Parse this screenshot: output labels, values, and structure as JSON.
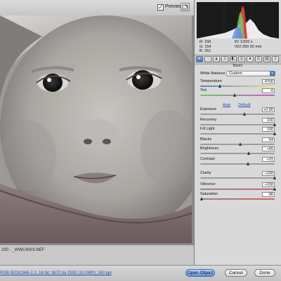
{
  "image_toolbar": {
    "preview_label": "Preview",
    "preview_checked": true,
    "fullscreen_icon": "fullscreen-icon"
  },
  "image_status": {
    "zoom_and_filename": "200   -   _WWC4003.NEF"
  },
  "readout": {
    "r": "R:  158",
    "g": "G:  154",
    "b": "B:  152",
    "exposure_line": "f/2    1/320 s",
    "iso_line": "ISO 200    50 mm"
  },
  "tool_tabs": [
    "basic",
    "tone-curve",
    "detail",
    "hsl",
    "split-toning",
    "lens",
    "camera",
    "presets",
    "snapshots"
  ],
  "section_title": "Basic",
  "white_balance": {
    "label": "White Balance :",
    "value": "Custom"
  },
  "auto_label": "Auto",
  "default_label": "Default",
  "controls": [
    {
      "label": "Temperature",
      "value": "4700",
      "level": 0.27
    },
    {
      "label": "Tint",
      "value": "-6",
      "level": 0.47
    },
    {
      "label": "Exposure",
      "value": "+0.80",
      "level": 0.6
    },
    {
      "label": "Recovery",
      "value": "100",
      "level": 1.0
    },
    {
      "label": "Fill Light",
      "value": "100",
      "level": 1.0
    },
    {
      "label": "Blacks",
      "value": "54",
      "level": 0.54
    },
    {
      "label": "Brightness",
      "value": "+65",
      "level": 0.66
    },
    {
      "label": "Contrast",
      "value": "+31",
      "level": 0.65
    },
    {
      "label": "Clarity",
      "value": "+100",
      "level": 1.0
    },
    {
      "label": "Vibrance",
      "value": "+100",
      "level": 1.0
    },
    {
      "label": "Saturation",
      "value": "-96",
      "level": 0.02
    }
  ],
  "bottom": {
    "workflow": "RGB IEC61966-2.1; 16 bit; 3872 by 2592 (10.0MP); 240 ppi",
    "open_object": "Open Object",
    "cancel": "Cancel",
    "done": "Done"
  }
}
